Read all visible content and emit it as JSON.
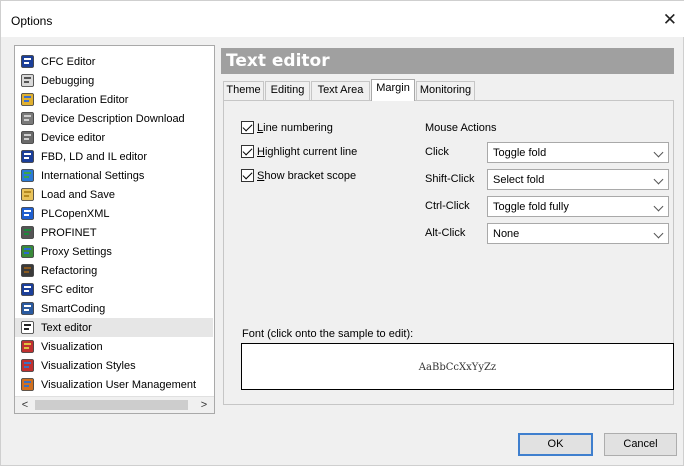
{
  "window": {
    "title": "Options",
    "close_glyph": "✕"
  },
  "tree": {
    "items": [
      {
        "label": "CFC Editor",
        "icon": "cfc-editor-icon",
        "selected": false
      },
      {
        "label": "Debugging",
        "icon": "debugging-icon",
        "selected": false
      },
      {
        "label": "Declaration Editor",
        "icon": "declaration-editor-icon",
        "selected": false
      },
      {
        "label": "Device Description Download",
        "icon": "device-description-icon",
        "selected": false
      },
      {
        "label": "Device editor",
        "icon": "device-editor-icon",
        "selected": false
      },
      {
        "label": "FBD, LD and IL editor",
        "icon": "fbd-editor-icon",
        "selected": false
      },
      {
        "label": "International Settings",
        "icon": "globe-icon",
        "selected": false
      },
      {
        "label": "Load and Save",
        "icon": "folder-icon",
        "selected": false
      },
      {
        "label": "PLCopenXML",
        "icon": "plcopenxml-icon",
        "selected": false
      },
      {
        "label": "PROFINET",
        "icon": "profinet-icon",
        "selected": false
      },
      {
        "label": "Proxy Settings",
        "icon": "proxy-icon",
        "selected": false
      },
      {
        "label": "Refactoring",
        "icon": "refactoring-icon",
        "selected": false
      },
      {
        "label": "SFC editor",
        "icon": "sfc-editor-icon",
        "selected": false
      },
      {
        "label": "SmartCoding",
        "icon": "smartcoding-icon",
        "selected": false
      },
      {
        "label": "Text editor",
        "icon": "text-editor-icon",
        "selected": true
      },
      {
        "label": "Visualization",
        "icon": "visualization-icon",
        "selected": false
      },
      {
        "label": "Visualization Styles",
        "icon": "visualization-styles-icon",
        "selected": false
      },
      {
        "label": "Visualization User Management",
        "icon": "user-management-icon",
        "selected": false
      }
    ],
    "scroll_left": "<",
    "scroll_right": ">"
  },
  "panel": {
    "header": "Text editor",
    "tabs": [
      {
        "label": "Theme",
        "active": false
      },
      {
        "label": "Editing",
        "active": false
      },
      {
        "label": "Text Area",
        "active": false
      },
      {
        "label": "Margin",
        "active": true
      },
      {
        "label": "Monitoring",
        "active": false
      }
    ],
    "checkboxes": [
      {
        "label": "Line numbering",
        "checked": true
      },
      {
        "label": "Highlight current line",
        "checked": true
      },
      {
        "label": "Show bracket scope",
        "checked": true
      }
    ],
    "mouse_actions": {
      "title": "Mouse Actions",
      "rows": [
        {
          "label": "Click",
          "value": "Toggle fold"
        },
        {
          "label": "Shift-Click",
          "value": "Select fold"
        },
        {
          "label": "Ctrl-Click",
          "value": "Toggle fold fully"
        },
        {
          "label": "Alt-Click",
          "value": "None"
        }
      ]
    },
    "font_label": "Font (click onto the sample to edit):",
    "font_sample": "AaBbCcXxYyZz"
  },
  "buttons": {
    "ok": "OK",
    "cancel": "Cancel"
  },
  "colors": {
    "header_bg": "#a0a0a0",
    "selection": "#e6e6e6",
    "default_button_border": "#3f7fce"
  }
}
